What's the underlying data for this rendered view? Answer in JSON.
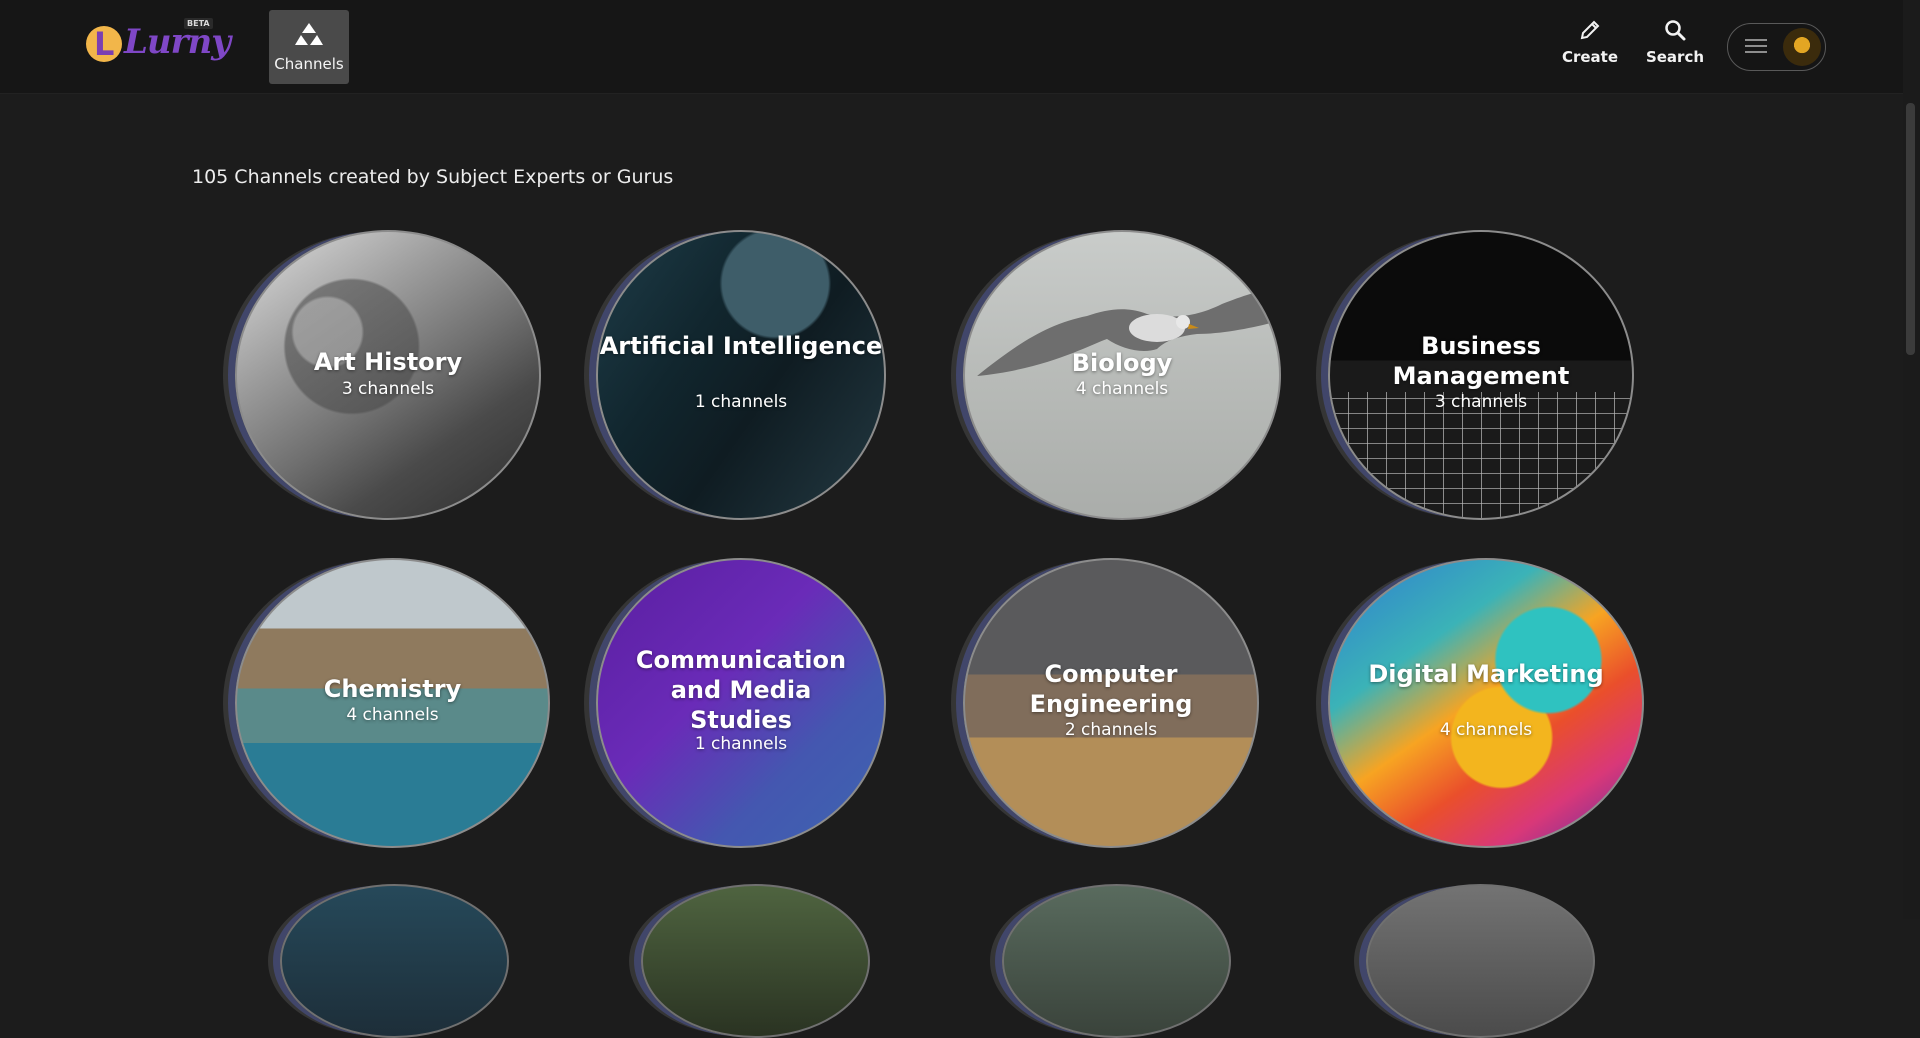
{
  "header": {
    "logo_text": "Lurny",
    "logo_badge": "BETA",
    "channels_label": "Channels",
    "create_label": "Create",
    "search_label": "Search"
  },
  "main": {
    "headline": "105 Channels created by Subject Experts or Gurus",
    "categories": [
      {
        "title": "Art History",
        "subtitle": "3 channels"
      },
      {
        "title": "Artificial Intelligence",
        "subtitle": "1 channels"
      },
      {
        "title": "Biology",
        "subtitle": "4 channels"
      },
      {
        "title": "Business Management",
        "subtitle": "3 channels"
      },
      {
        "title": "Chemistry",
        "subtitle": "4 channels"
      },
      {
        "title": "Communication and Media Studies",
        "subtitle": "1 channels"
      },
      {
        "title": "Computer Engineering",
        "subtitle": "2 channels"
      },
      {
        "title": "Digital Marketing",
        "subtitle": "4 channels"
      }
    ]
  },
  "icons": {
    "channels": "triangle-grid-icon",
    "create": "pencil-icon",
    "search": "search-icon",
    "menu": "hamburger-icon",
    "avatar": "user-avatar"
  },
  "colors": {
    "background": "#1c1c1c",
    "topbar": "#161616",
    "active_nav": "#4a4a4a",
    "logo_orange": "#f2b64a",
    "logo_purple": "#7f47c6"
  }
}
